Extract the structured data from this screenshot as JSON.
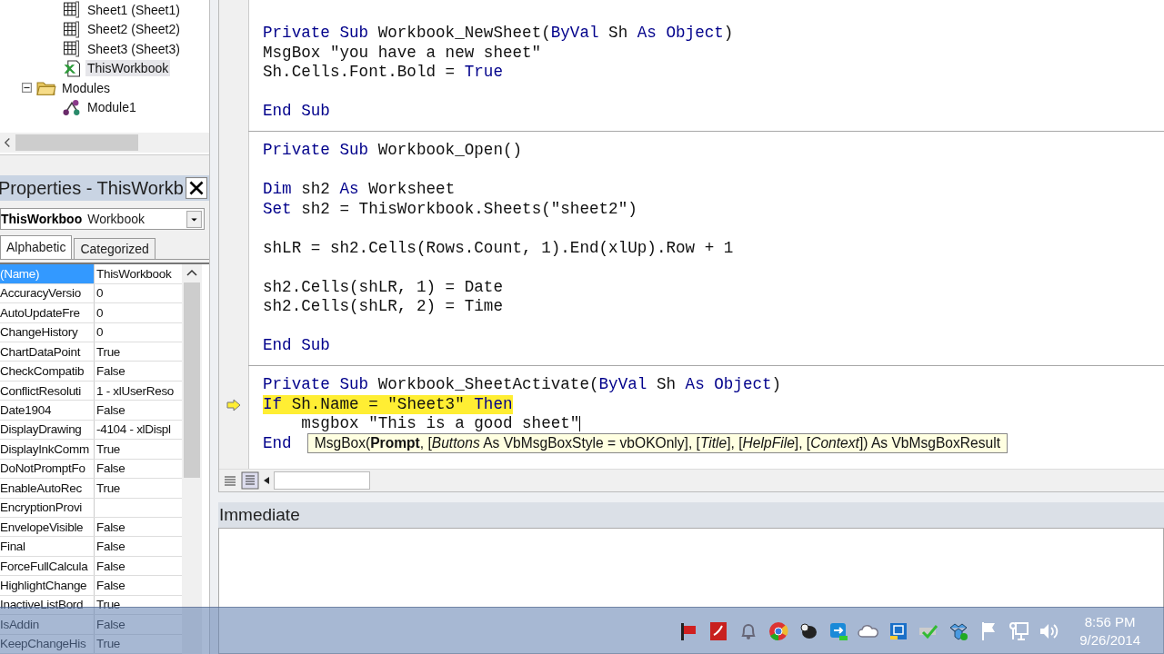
{
  "project_tree": [
    {
      "children": [
        {
          "label": "Sheet1 (Sheet1)",
          "kind": "sheet",
          "selected": false
        },
        {
          "label": "Sheet2 (Sheet2)",
          "kind": "sheet",
          "selected": false
        },
        {
          "label": "Sheet3 (Sheet3)",
          "kind": "sheet",
          "selected": false
        },
        {
          "label": "ThisWorkbook",
          "kind": "workbook",
          "selected": true
        }
      ]
    },
    {
      "label": "Modules",
      "kind": "folder",
      "expanded": true,
      "selected": false,
      "children": [
        {
          "label": "Module1",
          "kind": "module",
          "selected": false
        }
      ]
    }
  ],
  "properties": {
    "title": "Properties - ThisWorkb",
    "object_name": "ThisWorkboo",
    "object_type": "Workbook",
    "tabs": [
      {
        "label": "Alphabetic",
        "selected": true
      },
      {
        "label": "Categorized",
        "selected": false
      }
    ],
    "rows": [
      {
        "name": "(Name)",
        "value": "ThisWorkbook",
        "selected": true
      },
      {
        "name": "AccuracyVersio",
        "value": "0",
        "selected": false
      },
      {
        "name": "AutoUpdateFre",
        "value": "0",
        "selected": false
      },
      {
        "name": "ChangeHistory",
        "value": "0",
        "selected": false
      },
      {
        "name": "ChartDataPoint",
        "value": "True",
        "selected": false
      },
      {
        "name": "CheckCompatib",
        "value": "False",
        "selected": false
      },
      {
        "name": "ConflictResoluti",
        "value": "1 - xlUserReso",
        "selected": false
      },
      {
        "name": "Date1904",
        "value": "False",
        "selected": false
      },
      {
        "name": "DisplayDrawing",
        "value": "-4104 - xlDispl",
        "selected": false
      },
      {
        "name": "DisplayInkComm",
        "value": "True",
        "selected": false
      },
      {
        "name": "DoNotPromptFo",
        "value": "False",
        "selected": false
      },
      {
        "name": "EnableAutoRec",
        "value": "True",
        "selected": false
      },
      {
        "name": "EncryptionProvi",
        "selected": false
      },
      {
        "name": "EnvelopeVisible",
        "value": "False",
        "selected": false
      },
      {
        "name": "Final",
        "value": "False",
        "selected": false
      },
      {
        "name": "ForceFullCalcula",
        "value": "False",
        "selected": false
      },
      {
        "name": "HighlightChange",
        "value": "False",
        "selected": false
      },
      {
        "name": "InactiveListBord",
        "value": "True",
        "selected": false
      },
      {
        "name": "IsAddin",
        "value": "False",
        "selected": false
      },
      {
        "name": "KeepChangeHis",
        "value": "True",
        "selected": false
      }
    ]
  },
  "code": {
    "procedures": [
      {
        "lines": [
          {
            "kind": "code",
            "current": false,
            "tokens": [
              {
                "text": "Private Sub",
                "kind": "keyword"
              },
              {
                "text": " Workbook_NewSheet(",
                "kind": "plain"
              },
              {
                "text": "ByVal",
                "kind": "keyword"
              },
              {
                "text": " Sh ",
                "kind": "plain"
              },
              {
                "text": "As Object",
                "kind": "keyword"
              },
              {
                "text": ")",
                "kind": "plain"
              }
            ]
          },
          {
            "kind": "code",
            "current": false,
            "tokens": [
              {
                "text": "MsgBox \"you have a new sheet\"",
                "kind": "plain"
              }
            ]
          },
          {
            "kind": "code",
            "current": false,
            "tokens": [
              {
                "text": "Sh.Cells.Font.Bold = ",
                "kind": "plain"
              },
              {
                "text": "True",
                "kind": "keyword"
              }
            ]
          },
          {
            "kind": "blank"
          },
          {
            "kind": "code",
            "current": false,
            "tokens": [
              {
                "text": "End Sub",
                "kind": "keyword"
              }
            ]
          }
        ]
      },
      {
        "lines": [
          {
            "kind": "code",
            "current": false,
            "tokens": [
              {
                "text": "Private Sub",
                "kind": "keyword"
              },
              {
                "text": " Workbook_Open()",
                "kind": "plain"
              }
            ]
          },
          {
            "kind": "blank"
          },
          {
            "kind": "code",
            "current": false,
            "tokens": [
              {
                "text": "Dim",
                "kind": "keyword"
              },
              {
                "text": " sh2 ",
                "kind": "plain"
              },
              {
                "text": "As",
                "kind": "keyword"
              },
              {
                "text": " Worksheet",
                "kind": "plain"
              }
            ]
          },
          {
            "kind": "code",
            "current": false,
            "tokens": [
              {
                "text": "Set",
                "kind": "keyword"
              },
              {
                "text": " sh2 = ThisWorkbook.Sheets(\"sheet2\")",
                "kind": "plain"
              }
            ]
          },
          {
            "kind": "blank"
          },
          {
            "kind": "code",
            "current": false,
            "tokens": [
              {
                "text": "shLR = sh2.Cells(Rows.Count, 1).End(xlUp).Row + 1",
                "kind": "plain"
              }
            ]
          },
          {
            "kind": "blank"
          },
          {
            "kind": "code",
            "current": false,
            "tokens": [
              {
                "text": "sh2.Cells(shLR, 1) = Date",
                "kind": "plain"
              }
            ]
          },
          {
            "kind": "code",
            "current": false,
            "tokens": [
              {
                "text": "sh2.Cells(shLR, 2) = Time",
                "kind": "plain"
              }
            ]
          },
          {
            "kind": "blank"
          },
          {
            "kind": "code",
            "current": false,
            "tokens": [
              {
                "text": "End Sub",
                "kind": "keyword"
              }
            ]
          }
        ]
      },
      {
        "lines": [
          {
            "kind": "code",
            "current": false,
            "tokens": [
              {
                "text": "Private Sub",
                "kind": "keyword"
              },
              {
                "text": " Workbook_SheetActivate(",
                "kind": "plain"
              },
              {
                "text": "ByVal",
                "kind": "keyword"
              },
              {
                "text": " Sh ",
                "kind": "plain"
              },
              {
                "text": "As Object",
                "kind": "keyword"
              },
              {
                "text": ")",
                "kind": "plain"
              }
            ]
          },
          {
            "kind": "code",
            "current": true,
            "tokens": [
              {
                "text": "If",
                "kind": "keyword"
              },
              {
                "text": " Sh.Name = \"Sheet3\" ",
                "kind": "plain"
              },
              {
                "text": "Then",
                "kind": "keyword"
              }
            ]
          },
          {
            "kind": "code",
            "current": false,
            "caret": true,
            "tokens": [
              {
                "text": "    msgbox \"This is a good sheet\"",
                "kind": "plain"
              }
            ]
          },
          {
            "kind": "code",
            "current": false,
            "tokens": [
              {
                "text": "End",
                "kind": "keyword"
              }
            ],
            "tooltip": "MsgBox(**Prompt**, [*Buttons* As VbMsgBoxStyle = vbOKOnly], [*Title*], [*HelpFile*], [*Context*]) As VbMsgBoxResult"
          }
        ]
      }
    ]
  },
  "immediate": {
    "title": "Immediate"
  },
  "taskbar": {
    "time": "8:56 PM",
    "date": "9/26/2014"
  }
}
